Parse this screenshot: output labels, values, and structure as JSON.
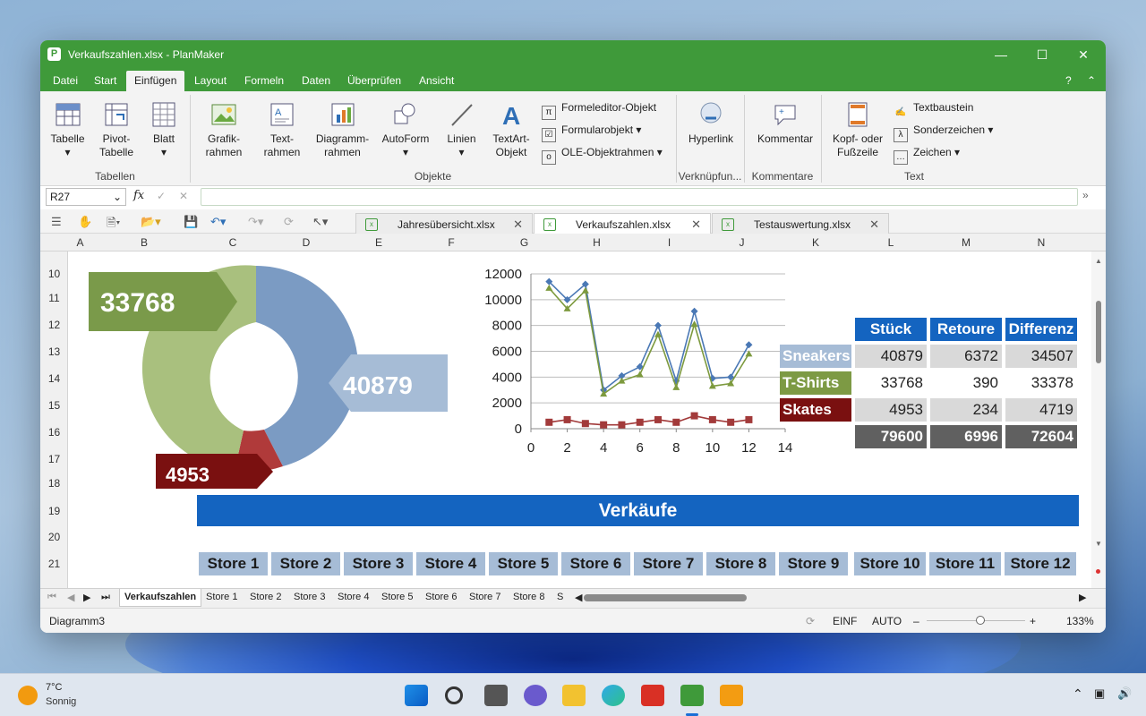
{
  "window": {
    "title": "Verkaufszahlen.xlsx - PlanMaker",
    "app_letter": "P"
  },
  "menu": {
    "items": [
      "Datei",
      "Start",
      "Einfügen",
      "Layout",
      "Formeln",
      "Daten",
      "Überprüfen",
      "Ansicht"
    ],
    "help": "?"
  },
  "ribbon": {
    "tabelle": "Tabelle",
    "pivot": "Pivot-\nTabelle",
    "blatt": "Blatt",
    "grafik": "Grafik-\nrahmen",
    "text": "Text-\nrahmen",
    "diagramm": "Diagramm-\nrahmen",
    "autoform": "AutoForm",
    "linien": "Linien",
    "textart": "TextArt-\nObjekt",
    "formeleditor": "Formeleditor-Objekt",
    "formularobjekt": "Formularobjekt",
    "ole": "OLE-Objektrahmen",
    "hyperlink": "Hyperlink",
    "kommentar": "Kommentar",
    "kopf": "Kopf- oder\nFußzeile",
    "textbaustein": "Textbaustein",
    "sonderzeichen": "Sonderzeichen",
    "zeichen": "Zeichen",
    "groups": {
      "tabellen": "Tabellen",
      "objekte": "Objekte",
      "verknuepfungen": "Verknüpfun...",
      "kommentare": "Kommentare",
      "text": "Text"
    }
  },
  "formula": {
    "cell_ref": "R27",
    "fx": "fx",
    "value": ""
  },
  "doc_tabs": [
    "Jahresübersicht.xlsx",
    "Verkaufszahlen.xlsx",
    "Testauswertung.xlsx"
  ],
  "columns": [
    "A",
    "B",
    "C",
    "D",
    "E",
    "F",
    "G",
    "H",
    "I",
    "J",
    "K",
    "L",
    "M",
    "N"
  ],
  "rows": [
    "10",
    "11",
    "12",
    "13",
    "14",
    "15",
    "16",
    "17",
    "18",
    "19",
    "20",
    "21"
  ],
  "donut": {
    "labels": [
      "33768",
      "40879",
      "4953"
    ]
  },
  "chart_data": {
    "type": "line",
    "x": [
      1,
      2,
      3,
      4,
      5,
      6,
      7,
      8,
      9,
      10,
      11,
      12
    ],
    "series": [
      {
        "values": [
          11400,
          10000,
          11200,
          3000,
          4100,
          4800,
          8000,
          3700,
          9100,
          3900,
          4000,
          6500
        ],
        "color": "#4a78b5",
        "marker": "diamond"
      },
      {
        "values": [
          10900,
          9300,
          10700,
          2700,
          3700,
          4200,
          7300,
          3200,
          8100,
          3300,
          3500,
          5800
        ],
        "color": "#7d9a3e",
        "marker": "triangle"
      },
      {
        "values": [
          500,
          700,
          400,
          300,
          300,
          500,
          700,
          500,
          1000,
          700,
          500,
          700
        ],
        "color": "#a23a3a",
        "marker": "square"
      }
    ],
    "xlim": [
      0,
      14
    ],
    "ylim": [
      0,
      12000
    ],
    "xticks": [
      "0",
      "2",
      "4",
      "6",
      "8",
      "10",
      "12",
      "14"
    ],
    "yticks": [
      "0",
      "2000",
      "4000",
      "6000",
      "8000",
      "10000",
      "12000"
    ],
    "grid": true
  },
  "table": {
    "headers": [
      "Stück",
      "Retoure",
      "Differenz"
    ],
    "rows": [
      {
        "name": "Sneakers",
        "values": [
          "40879",
          "6372",
          "34507"
        ]
      },
      {
        "name": "T-Shirts",
        "values": [
          "33768",
          "390",
          "33378"
        ]
      },
      {
        "name": "Skates",
        "values": [
          "4953",
          "234",
          "4719"
        ]
      }
    ],
    "totals": [
      "79600",
      "6996",
      "72604"
    ],
    "colors": {
      "header": "#1464c0",
      "sneakers": "#a6bcd6",
      "tshirts": "#7d9a44",
      "skates": "#7a1010",
      "total": "#606060"
    }
  },
  "banner": {
    "title": "Verkäufe",
    "color": "#1464c0"
  },
  "stores": [
    "Store 1",
    "Store 2",
    "Store 3",
    "Store 4",
    "Store 5",
    "Store 6",
    "Store 7",
    "Store 8",
    "Store 9",
    "Store 10",
    "Store 11",
    "Store 12"
  ],
  "sheet_tabs": [
    "Verkaufszahlen",
    "Store 1",
    "Store 2",
    "Store 3",
    "Store 4",
    "Store 5",
    "Store 6",
    "Store 7",
    "Store 8",
    "S"
  ],
  "status": {
    "left": "Diagramm3",
    "mode1": "EINF",
    "mode2": "AUTO",
    "zoom": "133%"
  },
  "taskbar": {
    "temp": "7°C",
    "weather": "Sonnig"
  }
}
